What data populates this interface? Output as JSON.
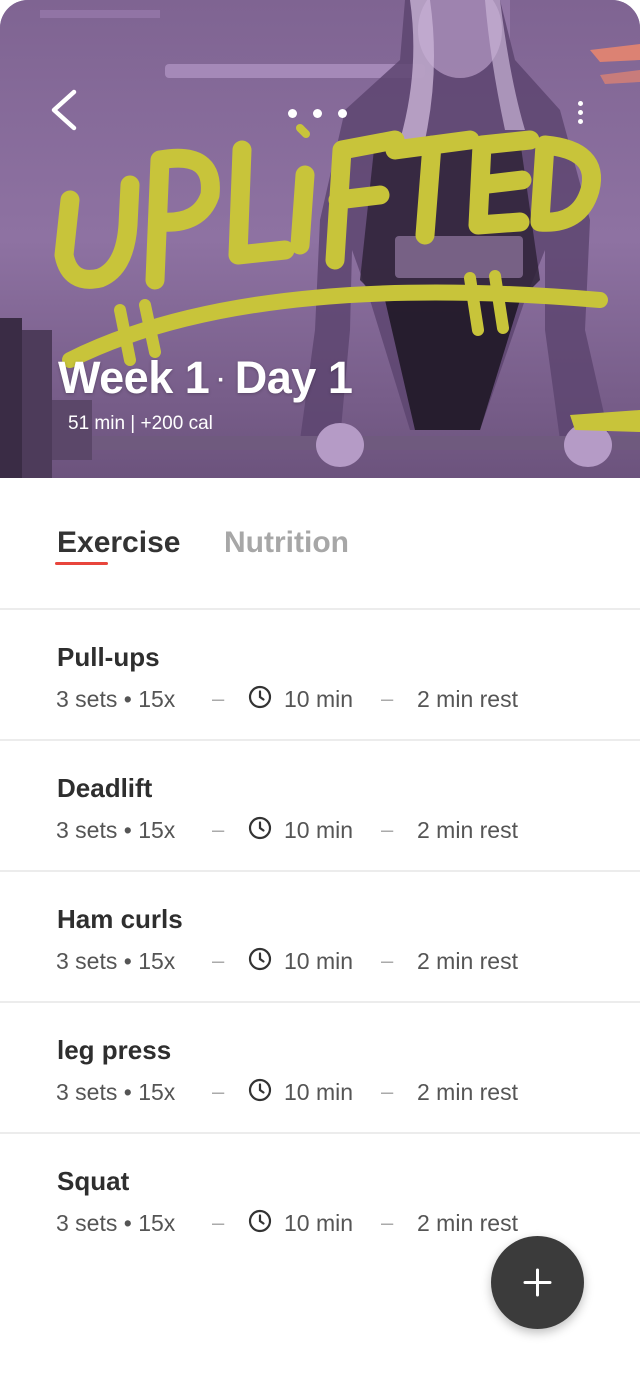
{
  "colors": {
    "hero_overlay": "#8a6d9e",
    "brand_lettering": "#c8c43a",
    "tab_indicator": "#e8453c",
    "fab": "#3b3b3b",
    "inactive_tab": "#a7a7a7"
  },
  "hero": {
    "brand_logo_text": "UPLIFTED",
    "title_week": "Week 1",
    "title_sep": "·",
    "title_day": "Day 1",
    "meta": "51 min | +200 cal",
    "back_icon": "chevron-left-icon",
    "more_icon": "more-vertical-icon",
    "pager_dots": 3
  },
  "tabs": [
    {
      "label": "Exercise",
      "active": true
    },
    {
      "label": "Nutrition",
      "active": false
    }
  ],
  "exercises": [
    {
      "name": "Pull-ups",
      "sets": "3 sets • 15x",
      "duration": "10 min",
      "rest": "2 min rest"
    },
    {
      "name": "Deadlift",
      "sets": "3 sets • 15x",
      "duration": "10 min",
      "rest": "2 min rest"
    },
    {
      "name": "Ham curls",
      "sets": "3 sets • 15x",
      "duration": "10 min",
      "rest": "2 min rest"
    },
    {
      "name": "leg press",
      "sets": "3 sets • 15x",
      "duration": "10 min",
      "rest": "2 min rest"
    },
    {
      "name": "Squat",
      "sets": "3 sets • 15x",
      "duration": "10 min",
      "rest": "2 min rest"
    }
  ],
  "separator": "–",
  "fab": {
    "icon": "plus-icon"
  }
}
